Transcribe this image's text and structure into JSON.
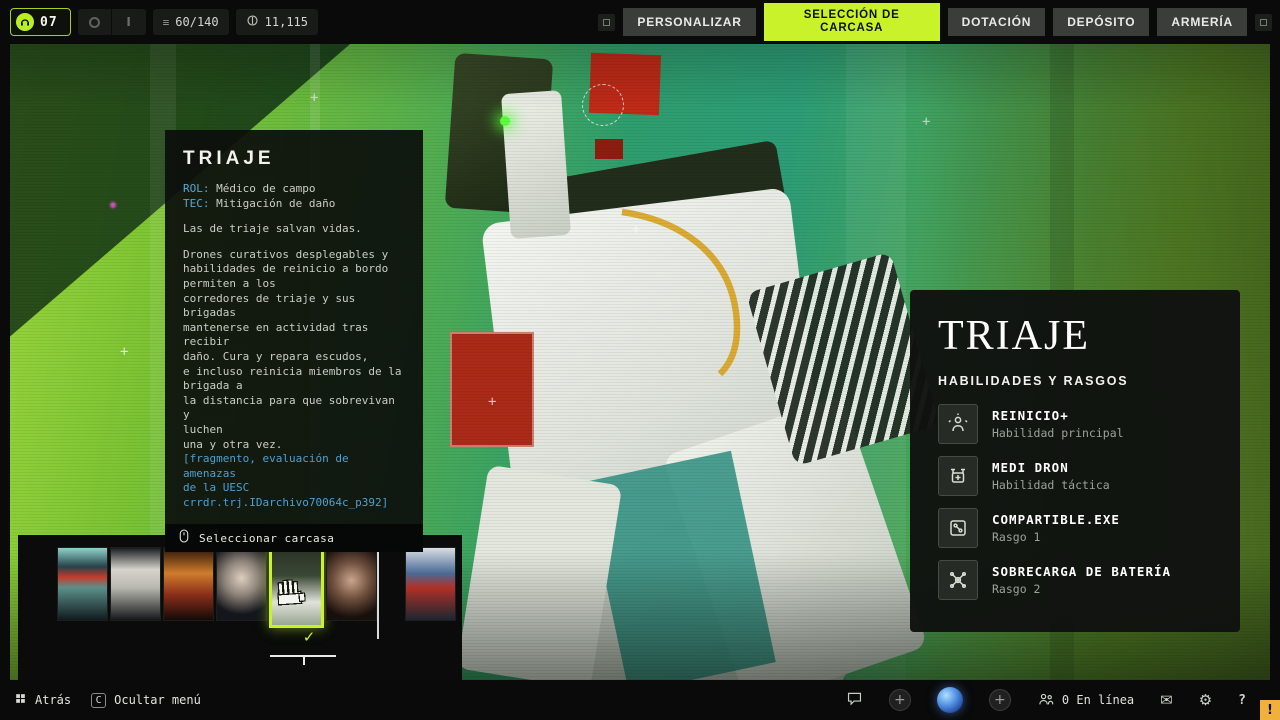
{
  "colors": {
    "accent": "#c9f22b",
    "info_blue": "#56a7d4",
    "alert": "#efb13a",
    "eye_glow": "#5bff3e"
  },
  "top_bar": {
    "level": {
      "icon": "headset-icon",
      "value": "07"
    },
    "status_icons": [
      {
        "icon": "ring-icon"
      },
      {
        "icon": "bar-icon",
        "glyph": "I"
      }
    ],
    "resources": {
      "icon": "stack-icon",
      "glyph": "≡",
      "value": "60/140"
    },
    "currency": {
      "icon": "credits-icon",
      "value": "11,115"
    },
    "tabs": [
      {
        "label": "PERSONALIZAR",
        "active": false
      },
      {
        "label": "SELECCIÓN DE CARCASA",
        "active": true
      },
      {
        "label": "DOTACIÓN",
        "active": false
      },
      {
        "label": "DEPÓSITO",
        "active": false
      },
      {
        "label": "ARMERÍA",
        "active": false
      }
    ]
  },
  "info_panel": {
    "title": "TRIAJE",
    "role_label": "ROL:",
    "role_value": " Médico de campo",
    "tech_label": "TEC:",
    "tech_value": " Mitigación de daño",
    "tagline": "Las de triaje salvan vidas.",
    "description": "Drones curativos desplegables y\nhabilidades de reinicio a bordo\npermiten a los\ncorredores de triaje y sus\nbrigadas\nmantenerse en actividad tras\nrecibir\ndaño. Cura y repara escudos,\ne incluso reinicia miembros de la\nbrigada a\nla distancia para que sobrevivan y\nluchen\nuna y otra vez.",
    "fragment": "[fragmento, evaluación de amenazas\nde la UESC\ncrrdr.trj.IDarchivo70064c_p392]",
    "select_icon": "mouse-icon",
    "select_label": "Seleccionar carcasa"
  },
  "shell_carousel": {
    "selected_index": 4,
    "count": 7,
    "selected_check": "✓"
  },
  "abilities_panel": {
    "title": "TRIAJE",
    "heading": "HABILIDADES Y RASGOS",
    "items": [
      {
        "icon": "revive-icon",
        "name": "REINICIO+",
        "type": "Habilidad principal"
      },
      {
        "icon": "medi-drone-icon",
        "name": "MEDI DRON",
        "type": "Habilidad táctica"
      },
      {
        "icon": "share-module-icon",
        "name": "COMPARTIBLE.EXE",
        "type": "Rasgo 1"
      },
      {
        "icon": "battery-overload-icon",
        "name": "SOBRECARGA DE BATERÍA",
        "type": "Rasgo 2"
      }
    ]
  },
  "bottom_bar": {
    "back": {
      "icon": "grid-icon",
      "label": "Atrás"
    },
    "hide_menu": {
      "key": "C",
      "label": "Ocultar menú"
    },
    "chat": {
      "icon": "chat-icon"
    },
    "add_left": {
      "label": "+"
    },
    "add_right": {
      "label": "+"
    },
    "online": {
      "icon": "people-icon",
      "label": "0 En línea"
    },
    "mail_glyph": "✉",
    "gear_glyph": "⚙",
    "help_label": "?",
    "alert_label": "!"
  }
}
